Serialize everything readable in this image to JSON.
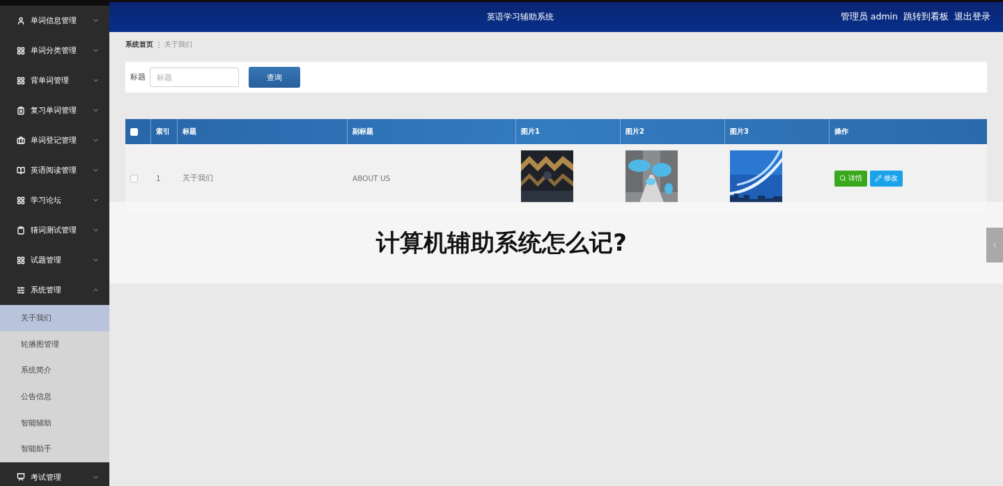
{
  "header": {
    "title": "英语学习辅助系统",
    "user": "管理员 admin",
    "links": [
      "跳转到看板",
      "退出登录"
    ]
  },
  "sidebar": {
    "items": [
      {
        "label": "单词信息管理",
        "expanded": false
      },
      {
        "label": "单词分类管理",
        "expanded": false
      },
      {
        "label": "背单词管理",
        "expanded": false
      },
      {
        "label": "复习单词管理",
        "expanded": false
      },
      {
        "label": "单词登记管理",
        "expanded": false
      },
      {
        "label": "英语阅读管理",
        "expanded": false
      },
      {
        "label": "学习论坛",
        "expanded": false
      },
      {
        "label": "猜词测试管理",
        "expanded": false
      },
      {
        "label": "试题管理",
        "expanded": false
      },
      {
        "label": "系统管理",
        "expanded": true,
        "children": [
          {
            "label": "关于我们",
            "selected": true
          },
          {
            "label": "轮播图管理",
            "selected": false
          },
          {
            "label": "系统简介",
            "selected": false
          },
          {
            "label": "公告信息",
            "selected": false
          },
          {
            "label": "智能辅助",
            "selected": false
          },
          {
            "label": "智能助手",
            "selected": false
          }
        ]
      },
      {
        "label": "考试管理",
        "expanded": false
      }
    ]
  },
  "breadcrumb": [
    "系统首页",
    "关于我们"
  ],
  "search": {
    "label": "标题",
    "placeholder": "标题",
    "button": "查询"
  },
  "table": {
    "header_checked": false,
    "columns": [
      {
        "label": "索引",
        "kind": "index"
      },
      {
        "label": "标题",
        "kind": "text"
      },
      {
        "label": "副标题",
        "kind": "text"
      },
      {
        "label": "图片1"
      },
      {
        "label": "图片2"
      },
      {
        "label": "图片3"
      },
      {
        "label": "操作",
        "kind": "actions"
      }
    ],
    "rows": [
      {
        "checked": false,
        "index": "1",
        "title": "关于我们",
        "subtitle": "ABOUT US",
        "images": [
          {
            "kind": "picture"
          },
          {
            "kind": "picture"
          },
          {
            "kind": "picture"
          }
        ],
        "actions": [
          {
            "label": "详情",
            "kind": "detail"
          },
          {
            "label": "修改",
            "kind": "edit"
          }
        ]
      }
    ]
  },
  "banner": {
    "text": "计算机辅助系统怎么记?"
  }
}
